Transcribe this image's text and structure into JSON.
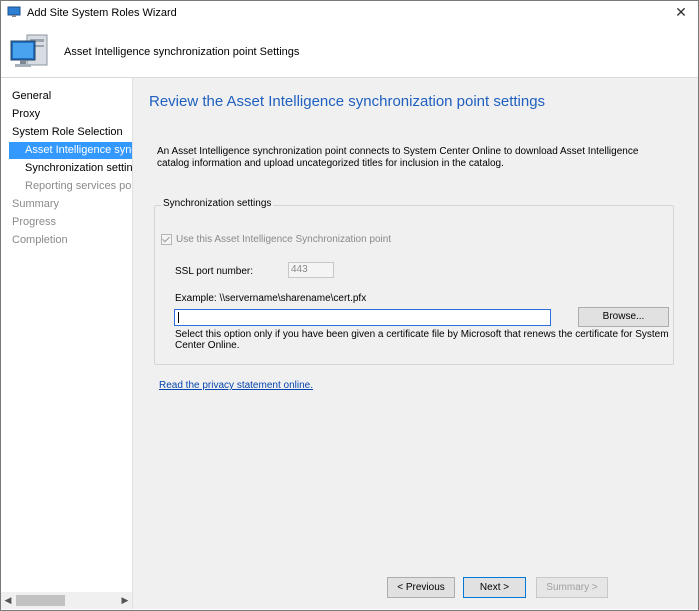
{
  "window": {
    "title": "Add Site System Roles Wizard",
    "close_glyph": "✕",
    "header_title": "Asset Intelligence synchronization point Settings"
  },
  "nav": {
    "items": [
      {
        "label": "General",
        "state": "dim-black"
      },
      {
        "label": "Proxy"
      },
      {
        "label": "System Role Selection"
      },
      {
        "label": "Asset Intelligence synchronization point",
        "selected": true
      },
      {
        "label": "Synchronization settings"
      },
      {
        "label": "Reporting services point"
      },
      {
        "label": "Summary"
      },
      {
        "label": "Progress"
      },
      {
        "label": "Completion"
      }
    ],
    "scroll_left": "◀",
    "scroll_right": "▶"
  },
  "main": {
    "page_title": "Review the Asset Intelligence synchronization point settings",
    "description": "An Asset Intelligence synchronization point connects to System Center Online to download Asset Intelligence catalog information and upload uncategorized titles for inclusion in the catalog.",
    "group_label": "Synchronization settings",
    "use_sync_point_label": "Use this Asset Intelligence Synchronization point",
    "use_sync_point_checked": true,
    "ssl_label": "SSL port number:",
    "ssl_value": "443",
    "example_text": "Example: \\\\servername\\sharename\\cert.pfx",
    "cert_path_value": "",
    "browse_label": "Browse...",
    "note_text": "Select this option only if you have been given a certificate file by Microsoft that renews the certificate for System Center Online.",
    "privacy_link": "Read the privacy statement online."
  },
  "footer": {
    "previous_label": "< Previous",
    "next_label": "Next >",
    "summary_label": "Summary >"
  },
  "colors": {
    "accent": "#1f5fbf",
    "selection": "#3399ff",
    "link": "#0645ad"
  },
  "icons": {
    "app": "wizard-computer-icon",
    "header": "computer-monitor-icon"
  }
}
